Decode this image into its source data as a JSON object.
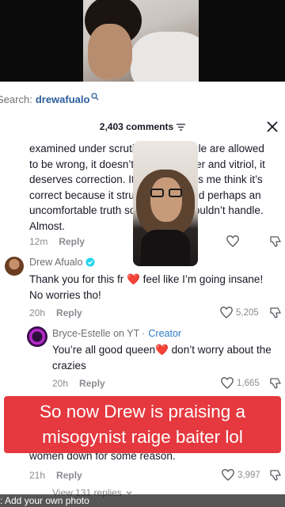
{
  "search": {
    "prefix": "Search:",
    "query": "drewafualo",
    "icon": "search-icon"
  },
  "comments_header": {
    "count_label": "2,403 comments",
    "filter_icon": "filter-icon",
    "close_icon": "close-icon"
  },
  "comments": [
    {
      "text_lines": [
        "examined under scrutiny. Ok? People are allowed",
        "to be wrong, it doesn’t deserve anger and vitriol, it",
        "deserves correction. It almost makes me think it’s",
        "correct because it struck a nerve and perhaps an",
        "uncomfortable truth some people couldn’t handle.",
        "Almost."
      ],
      "time": "12m",
      "reply_label": "Reply"
    },
    {
      "author": "Drew Afualo",
      "text_lines": [
        "Thank you for this fr ❤️ feel like I’m going insane!",
        "No worries tho!"
      ],
      "time": "20h",
      "reply_label": "Reply",
      "likes": "5,205"
    },
    {
      "author": "Bryce-Estelle on YT",
      "badge": "Creator",
      "text_lines": [
        "You’re all good queen❤️ don’t worry about the",
        "crazies"
      ],
      "time": "20h",
      "reply_label": "Reply",
      "likes": "1,665"
    },
    {
      "text_lines": [
        "women down for some reason."
      ],
      "time": "21h",
      "reply_label": "Reply",
      "likes": "3,997"
    }
  ],
  "view_replies_label": "View 131 replies",
  "banner": {
    "line1": "So now Drew is praising a",
    "line2": "misogynist raige baiter lol",
    "color": "#e5383f"
  },
  "bottom_strip": {
    "text": ": Add your own photo"
  },
  "colors": {
    "link_blue": "#2b5e9c",
    "creator_blue": "#2b7bbf",
    "muted": "#8a8b91",
    "heart_red": "#e0245e"
  }
}
